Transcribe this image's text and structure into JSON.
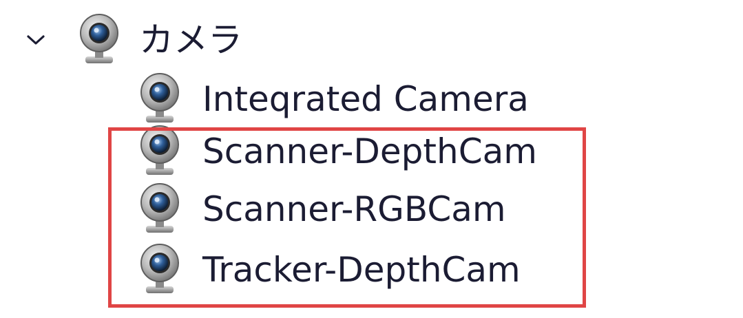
{
  "tree": {
    "category": {
      "label": "カメラ",
      "icon": "webcam-icon",
      "expanded": true,
      "expander_icon": "chevron-down-icon"
    },
    "devices": [
      {
        "label": "Inteqrated Camera",
        "icon": "webcam-icon"
      },
      {
        "label": "Scanner-DepthCam",
        "icon": "webcam-icon"
      },
      {
        "label": "Scanner-RGBCam",
        "icon": "webcam-icon"
      },
      {
        "label": "Tracker-DepthCam",
        "icon": "webcam-icon"
      }
    ]
  },
  "highlight": {
    "color": "#e04545",
    "items": [
      "Scanner-DepthCam",
      "Scanner-RGBCam",
      "Tracker-DepthCam"
    ]
  },
  "colors": {
    "text": "#1b1c33",
    "background": "#ffffff"
  }
}
